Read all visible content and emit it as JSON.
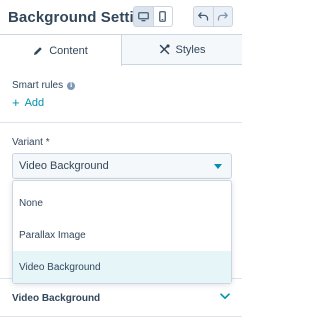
{
  "header": {
    "title": "Background Setti...",
    "device_buttons": [
      {
        "name": "desktop",
        "icon": "desktop-icon",
        "active": true
      },
      {
        "name": "mobile",
        "icon": "mobile-icon",
        "active": false
      }
    ],
    "undo_icon": "undo-icon",
    "redo_icon": "redo-icon"
  },
  "tabs": [
    {
      "label": "Content",
      "icon": "pencil-icon",
      "active": true
    },
    {
      "label": "Styles",
      "icon": "tools-icon",
      "active": false
    }
  ],
  "smart_rules": {
    "label": "Smart rules",
    "info_glyph": "i",
    "add_label": "Add",
    "add_glyph": "+"
  },
  "variant": {
    "label": "Variant *",
    "selected": "Video Background",
    "options": [
      "None",
      "Parallax Image",
      "Video Background"
    ]
  },
  "section": {
    "label": "Video Background"
  },
  "colors": {
    "accent": "#0091ae",
    "text": "#33475b",
    "border": "#cbd6e2",
    "selected_option_bg": "#e5f5f8"
  }
}
